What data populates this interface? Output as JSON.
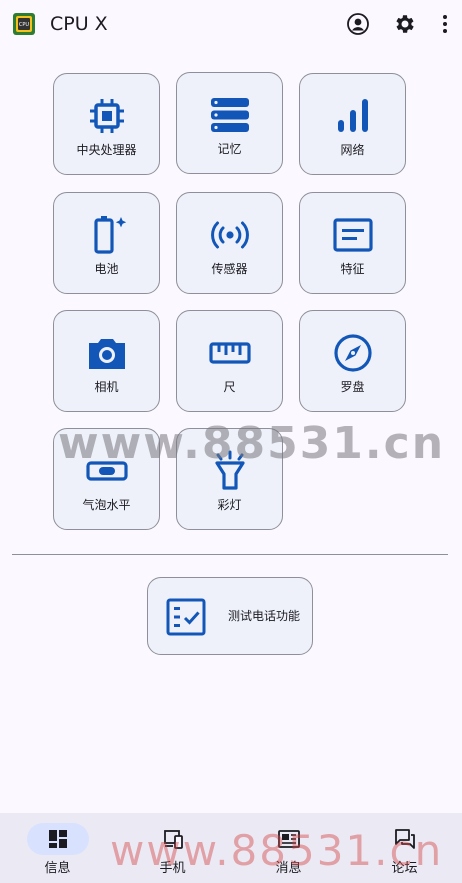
{
  "app": {
    "title": "CPU X",
    "logo_text": "CPU"
  },
  "appbar": {
    "icons": [
      "account-icon",
      "gear-icon",
      "more-vert-icon"
    ]
  },
  "tiles": [
    {
      "label": "中央处理器",
      "icon": "cpu-chip-icon"
    },
    {
      "label": "记忆",
      "icon": "memory-storage-icon"
    },
    {
      "label": "网络",
      "icon": "signal-bars-icon"
    },
    {
      "label": "电池",
      "icon": "battery-icon"
    },
    {
      "label": "传感器",
      "icon": "sensor-broadcast-icon"
    },
    {
      "label": "特征",
      "icon": "feature-card-icon"
    },
    {
      "label": "相机",
      "icon": "camera-icon"
    },
    {
      "label": "尺",
      "icon": "ruler-icon"
    },
    {
      "label": "罗盘",
      "icon": "compass-icon"
    },
    {
      "label": "气泡水平",
      "icon": "bubble-level-icon"
    },
    {
      "label": "彩灯",
      "icon": "flashlight-icon"
    }
  ],
  "test_phone": {
    "label": "测试电话功能",
    "icon": "checklist-icon"
  },
  "watermarks": [
    "www.88531.cn",
    "www.88531.cn"
  ],
  "bottom_nav": [
    {
      "label": "信息",
      "icon": "dashboard-icon",
      "active": true
    },
    {
      "label": "手机",
      "icon": "devices-icon",
      "active": false
    },
    {
      "label": "消息",
      "icon": "news-icon",
      "active": false
    },
    {
      "label": "论坛",
      "icon": "forum-icon",
      "active": false
    }
  ],
  "colors": {
    "accent": "#1257b8",
    "background": "#fcf8ff",
    "tile": "#eff1fa",
    "nav_active": "#d8e2ff"
  }
}
